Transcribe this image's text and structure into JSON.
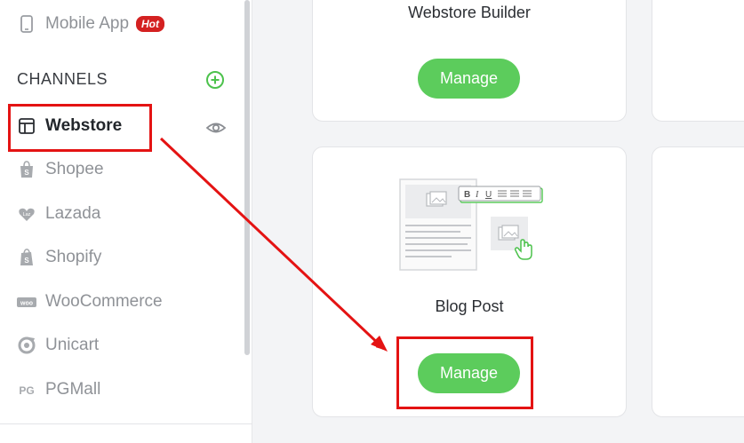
{
  "sidebar": {
    "mobile_app": {
      "label": "Mobile App",
      "badge": "Hot"
    },
    "section_header": "CHANNELS",
    "items": [
      {
        "label": "Webstore",
        "icon": "layout-icon"
      },
      {
        "label": "Shopee",
        "icon": "shopee-bag-icon"
      },
      {
        "label": "Lazada",
        "icon": "lazada-heart-icon"
      },
      {
        "label": "Shopify",
        "icon": "shopify-bag-icon"
      },
      {
        "label": "WooCommerce",
        "icon": "woocommerce-icon"
      },
      {
        "label": "Unicart",
        "icon": "unicart-icon"
      },
      {
        "label": "PGMall",
        "icon": "pgmall-icon"
      }
    ]
  },
  "main": {
    "cards": [
      {
        "title": "Webstore Builder",
        "button": "Manage"
      },
      {
        "title": "Blog Post",
        "button": "Manage"
      }
    ]
  },
  "colors": {
    "accent_green": "#5ccc5c",
    "highlight_red": "#e41313",
    "hot_badge": "#d42121"
  }
}
